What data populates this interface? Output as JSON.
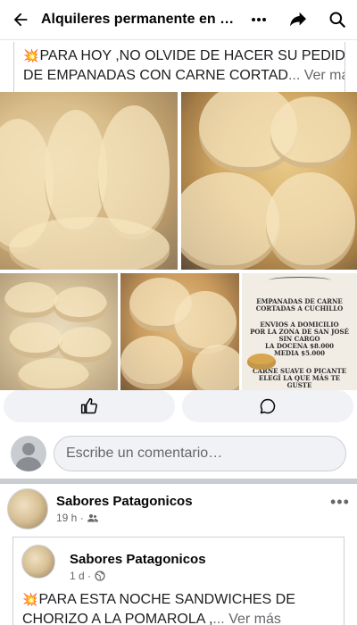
{
  "header": {
    "title": "Alquileres permanente en E..."
  },
  "post": {
    "text_line1": "PARA HOY ,NO OLVIDE DE HACER SU PEDIDO,",
    "text_line2": "DE EMPANADAS CON CARNE CORTAD",
    "see_more": "... Ver más",
    "emoji": "💥"
  },
  "flyer": {
    "line1": "EMPANADAS DE CARNE",
    "line2": "CORTADAS A CUCHILLO",
    "line3": "ENVIOS A DOMICILIO",
    "line4": "POR LA ZONA DE SAN JOSÉ",
    "line5": "SIN CARGO",
    "line6": "LA DOCENA $8.000",
    "line7": "MEDIA $5.000",
    "line8": "CARNE SUAVE O PICANTE",
    "line9": "ELEGÍ LA QUE MÁS TE GUSTE"
  },
  "actions": {
    "like_icon": "thumbs-up-icon",
    "comment_icon": "comment-icon"
  },
  "comment": {
    "placeholder": "Escribe un comentario…"
  },
  "post2": {
    "author": "Sabores Patagonicos",
    "time": "19 h ·",
    "audience_icon": "group-icon",
    "more": "•••",
    "shared": {
      "author": "Sabores Patagonicos",
      "time": "1 d ·",
      "audience_icon": "globe-icon",
      "emoji": "💥",
      "text_line1": "PARA ESTA NOCHE SANDWICHES DE",
      "text_line2": "CHORIZO A LA POMAROLA ,",
      "see_more": "... Ver más"
    }
  }
}
